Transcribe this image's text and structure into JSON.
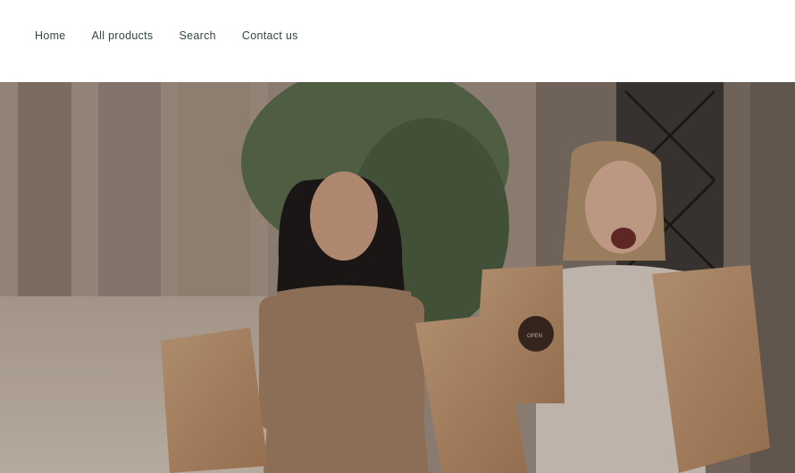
{
  "nav": {
    "items": [
      "Home",
      "All products",
      "Search",
      "Contact us"
    ]
  },
  "hero": {
    "image_description_icon": "shopping-women-photo",
    "bag_logo_text": "OPEN"
  },
  "colors": {
    "header_bg": "#ffffff",
    "nav_text": "#334444"
  }
}
